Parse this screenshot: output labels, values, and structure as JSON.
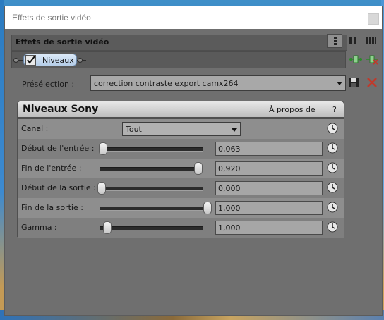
{
  "window": {
    "title": "Effets de sortie vidéo"
  },
  "header": {
    "title": "Effets de sortie vidéo",
    "view_buttons": [
      "list-view-icon",
      "grid-view-icon",
      "detail-view-icon"
    ]
  },
  "chain": {
    "plugin_label": "Niveaux",
    "checked": true
  },
  "preset": {
    "label": "Présélection :",
    "value": "correction contraste export camx264"
  },
  "plugin": {
    "name": "Niveaux Sony",
    "about_label": "À propos de",
    "help_label": "?"
  },
  "params": [
    {
      "label": "Canal :",
      "type": "select",
      "value": "Tout"
    },
    {
      "label": "Début de l'entrée :",
      "type": "slider",
      "value": "0,063",
      "fraction": 0.063
    },
    {
      "label": "Fin de l'entrée :",
      "type": "slider",
      "value": "0,920",
      "fraction": 0.92
    },
    {
      "label": "Début de la sortie :",
      "type": "slider",
      "value": "0,000",
      "fraction": 0.0
    },
    {
      "label": "Fin de la sortie :",
      "type": "slider",
      "value": "1,000",
      "fraction": 1.0
    },
    {
      "label": "Gamma :",
      "type": "slider",
      "value": "1,000",
      "fraction": 0.1
    }
  ],
  "colors": {
    "accent_green": "#2a8a2a",
    "delete_red": "#c0392b"
  }
}
